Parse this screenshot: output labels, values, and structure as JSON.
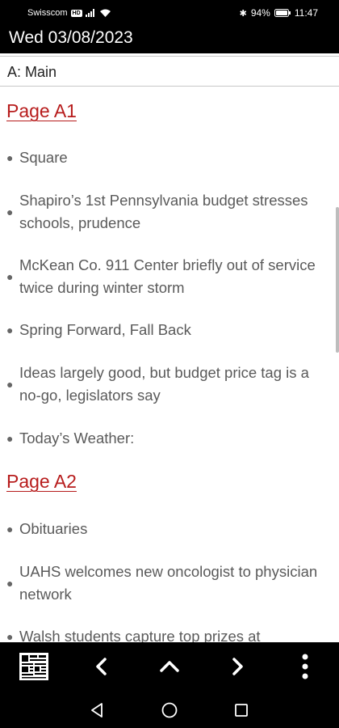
{
  "status_bar": {
    "carrier": "Swisscom",
    "carrier_badge": "HD",
    "battery": "94%",
    "time": "11:47"
  },
  "app_bar": {
    "date": "Wed 03/08/2023"
  },
  "section": {
    "label": "A: Main"
  },
  "pages": [
    {
      "heading": "Page A1",
      "items": [
        "Square",
        "Shapiro’s 1st Pennsylvania budget stresses schools, prudence",
        "McKean Co. 911 Center briefly out of service twice during winter storm",
        "Spring Forward, Fall Back",
        "Ideas largely good, but budget price tag is a no-go, legislators say",
        "Today’s Weather:"
      ]
    },
    {
      "heading": "Page A2",
      "items": [
        "Obituaries",
        "UAHS welcomes new oncologist to physician network",
        "Walsh students capture top prizes at"
      ]
    }
  ],
  "bottom_nav": {
    "icons": [
      "newspaper-grid-icon",
      "chevron-left-icon",
      "chevron-up-icon",
      "chevron-right-icon",
      "more-vert-icon"
    ]
  },
  "system_nav": {
    "icons": [
      "back-icon",
      "home-icon",
      "recents-icon"
    ]
  }
}
